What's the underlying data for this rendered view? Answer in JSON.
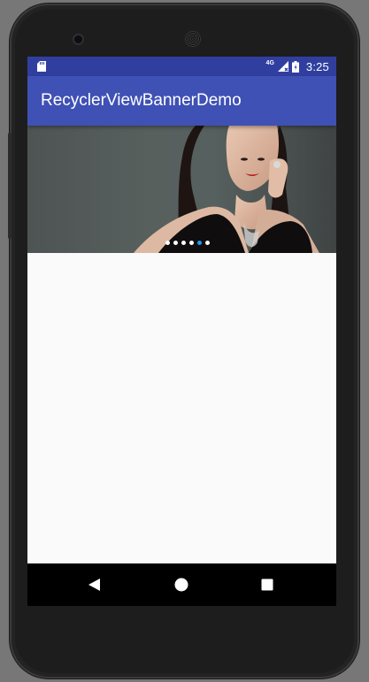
{
  "status_bar": {
    "network_label": "4G",
    "time": "3:25",
    "color": "#303f9f",
    "icons": [
      "sd-card-icon",
      "signal-icon",
      "battery-icon"
    ]
  },
  "app_bar": {
    "title": "RecyclerViewBannerDemo",
    "color": "#3f51b5"
  },
  "banner": {
    "indicator_count": 6,
    "active_index": 4,
    "active_color": "#2196f3",
    "inactive_color": "#ffffff"
  },
  "nav_bar": {
    "icons": [
      "back-icon",
      "home-icon",
      "recent-apps-icon"
    ]
  }
}
